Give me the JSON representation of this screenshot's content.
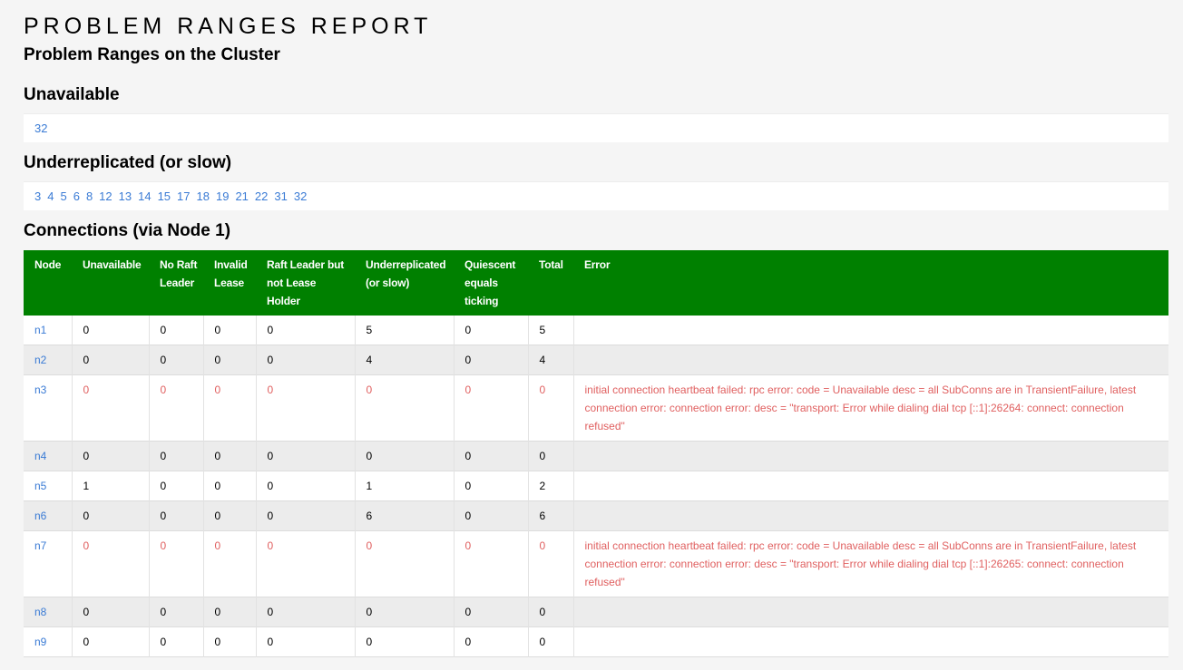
{
  "report": {
    "title": "PROBLEM RANGES REPORT",
    "subtitle": "Problem Ranges on the Cluster"
  },
  "unavailable": {
    "heading": "Unavailable",
    "ranges": [
      "32"
    ]
  },
  "underreplicated": {
    "heading": "Underreplicated (or slow)",
    "ranges": [
      "3",
      "4",
      "5",
      "6",
      "8",
      "12",
      "13",
      "14",
      "15",
      "17",
      "18",
      "19",
      "21",
      "22",
      "31",
      "32"
    ]
  },
  "connections": {
    "heading": "Connections (via Node 1)",
    "columns": [
      "Node",
      "Unavailable",
      "No Raft Leader",
      "Invalid Lease",
      "Raft Leader but not Lease Holder",
      "Underreplicated (or slow)",
      "Quiescent equals ticking",
      "Total",
      "Error"
    ],
    "rows": [
      {
        "node": "n1",
        "unavailable": "0",
        "no_raft_leader": "0",
        "invalid_lease": "0",
        "raft_leader_not_lease_holder": "0",
        "underreplicated": "5",
        "quiescent_ticking": "0",
        "total": "5",
        "error": ""
      },
      {
        "node": "n2",
        "unavailable": "0",
        "no_raft_leader": "0",
        "invalid_lease": "0",
        "raft_leader_not_lease_holder": "0",
        "underreplicated": "4",
        "quiescent_ticking": "0",
        "total": "4",
        "error": ""
      },
      {
        "node": "n3",
        "unavailable": "0",
        "no_raft_leader": "0",
        "invalid_lease": "0",
        "raft_leader_not_lease_holder": "0",
        "underreplicated": "0",
        "quiescent_ticking": "0",
        "total": "0",
        "error": "initial connection heartbeat failed: rpc error: code = Unavailable desc = all SubConns are in TransientFailure, latest connection error: connection error: desc = \"transport: Error while dialing dial tcp [::1]:26264: connect: connection refused\""
      },
      {
        "node": "n4",
        "unavailable": "0",
        "no_raft_leader": "0",
        "invalid_lease": "0",
        "raft_leader_not_lease_holder": "0",
        "underreplicated": "0",
        "quiescent_ticking": "0",
        "total": "0",
        "error": ""
      },
      {
        "node": "n5",
        "unavailable": "1",
        "no_raft_leader": "0",
        "invalid_lease": "0",
        "raft_leader_not_lease_holder": "0",
        "underreplicated": "1",
        "quiescent_ticking": "0",
        "total": "2",
        "error": ""
      },
      {
        "node": "n6",
        "unavailable": "0",
        "no_raft_leader": "0",
        "invalid_lease": "0",
        "raft_leader_not_lease_holder": "0",
        "underreplicated": "6",
        "quiescent_ticking": "0",
        "total": "6",
        "error": ""
      },
      {
        "node": "n7",
        "unavailable": "0",
        "no_raft_leader": "0",
        "invalid_lease": "0",
        "raft_leader_not_lease_holder": "0",
        "underreplicated": "0",
        "quiescent_ticking": "0",
        "total": "0",
        "error": "initial connection heartbeat failed: rpc error: code = Unavailable desc = all SubConns are in TransientFailure, latest connection error: connection error: desc = \"transport: Error while dialing dial tcp [::1]:26265: connect: connection refused\""
      },
      {
        "node": "n8",
        "unavailable": "0",
        "no_raft_leader": "0",
        "invalid_lease": "0",
        "raft_leader_not_lease_holder": "0",
        "underreplicated": "0",
        "quiescent_ticking": "0",
        "total": "0",
        "error": ""
      },
      {
        "node": "n9",
        "unavailable": "0",
        "no_raft_leader": "0",
        "invalid_lease": "0",
        "raft_leader_not_lease_holder": "0",
        "underreplicated": "0",
        "quiescent_ticking": "0",
        "total": "0",
        "error": ""
      }
    ]
  },
  "colors": {
    "header_green": "#008000",
    "link_blue": "#3a7bd5",
    "error_red": "#e06060",
    "page_background": "#f5f5f5"
  }
}
